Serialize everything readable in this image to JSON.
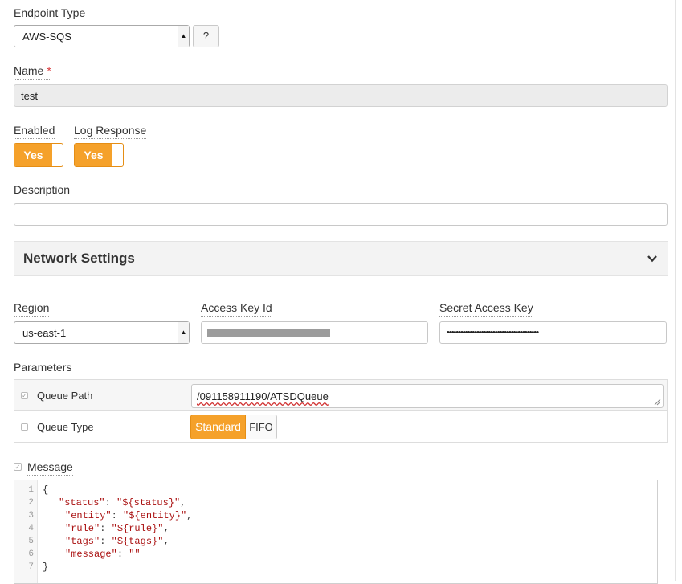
{
  "endpoint": {
    "label": "Endpoint Type",
    "value": "AWS-SQS",
    "help_label": "?"
  },
  "name": {
    "label": "Name",
    "required_mark": "*",
    "value": "test"
  },
  "enabled": {
    "label": "Enabled",
    "toggle_label": "Yes"
  },
  "log_response": {
    "label": "Log Response",
    "toggle_label": "Yes"
  },
  "description": {
    "label": "Description",
    "value": ""
  },
  "network_settings": {
    "title": "Network Settings",
    "expanded": true
  },
  "region": {
    "label": "Region",
    "value": "us-east-1"
  },
  "access_key": {
    "label": "Access Key Id"
  },
  "secret_key": {
    "label": "Secret Access Key",
    "value": "••••••••••••••••••••••••••••••••••••••••"
  },
  "parameters": {
    "label": "Parameters",
    "rows": [
      {
        "label": "Queue Path",
        "checked": true,
        "value": "/091158911190/ATSDQueue"
      },
      {
        "label": "Queue Type",
        "checked": false,
        "options": [
          "Standard",
          "FIFO"
        ],
        "selected": "Standard"
      }
    ]
  },
  "message": {
    "label": "Message",
    "checked": true,
    "line_numbers": [
      "1",
      "2",
      "3",
      "4",
      "5",
      "6",
      "7"
    ],
    "lines": [
      {
        "key": "",
        "val": "",
        "raw": "{"
      },
      {
        "key": "\"status\"",
        "val": "\"${status}\""
      },
      {
        "key": "\"entity\"",
        "val": "\"${entity}\""
      },
      {
        "key": "\"rule\"",
        "val": "\"${rule}\""
      },
      {
        "key": "\"tags\"",
        "val": "\"${tags}\""
      },
      {
        "key": "\"message\"",
        "val": "\"\""
      },
      {
        "key": "",
        "val": "",
        "raw": "}"
      }
    ]
  },
  "colors": {
    "accent": "#f5a12a",
    "required": "#d9383a"
  }
}
